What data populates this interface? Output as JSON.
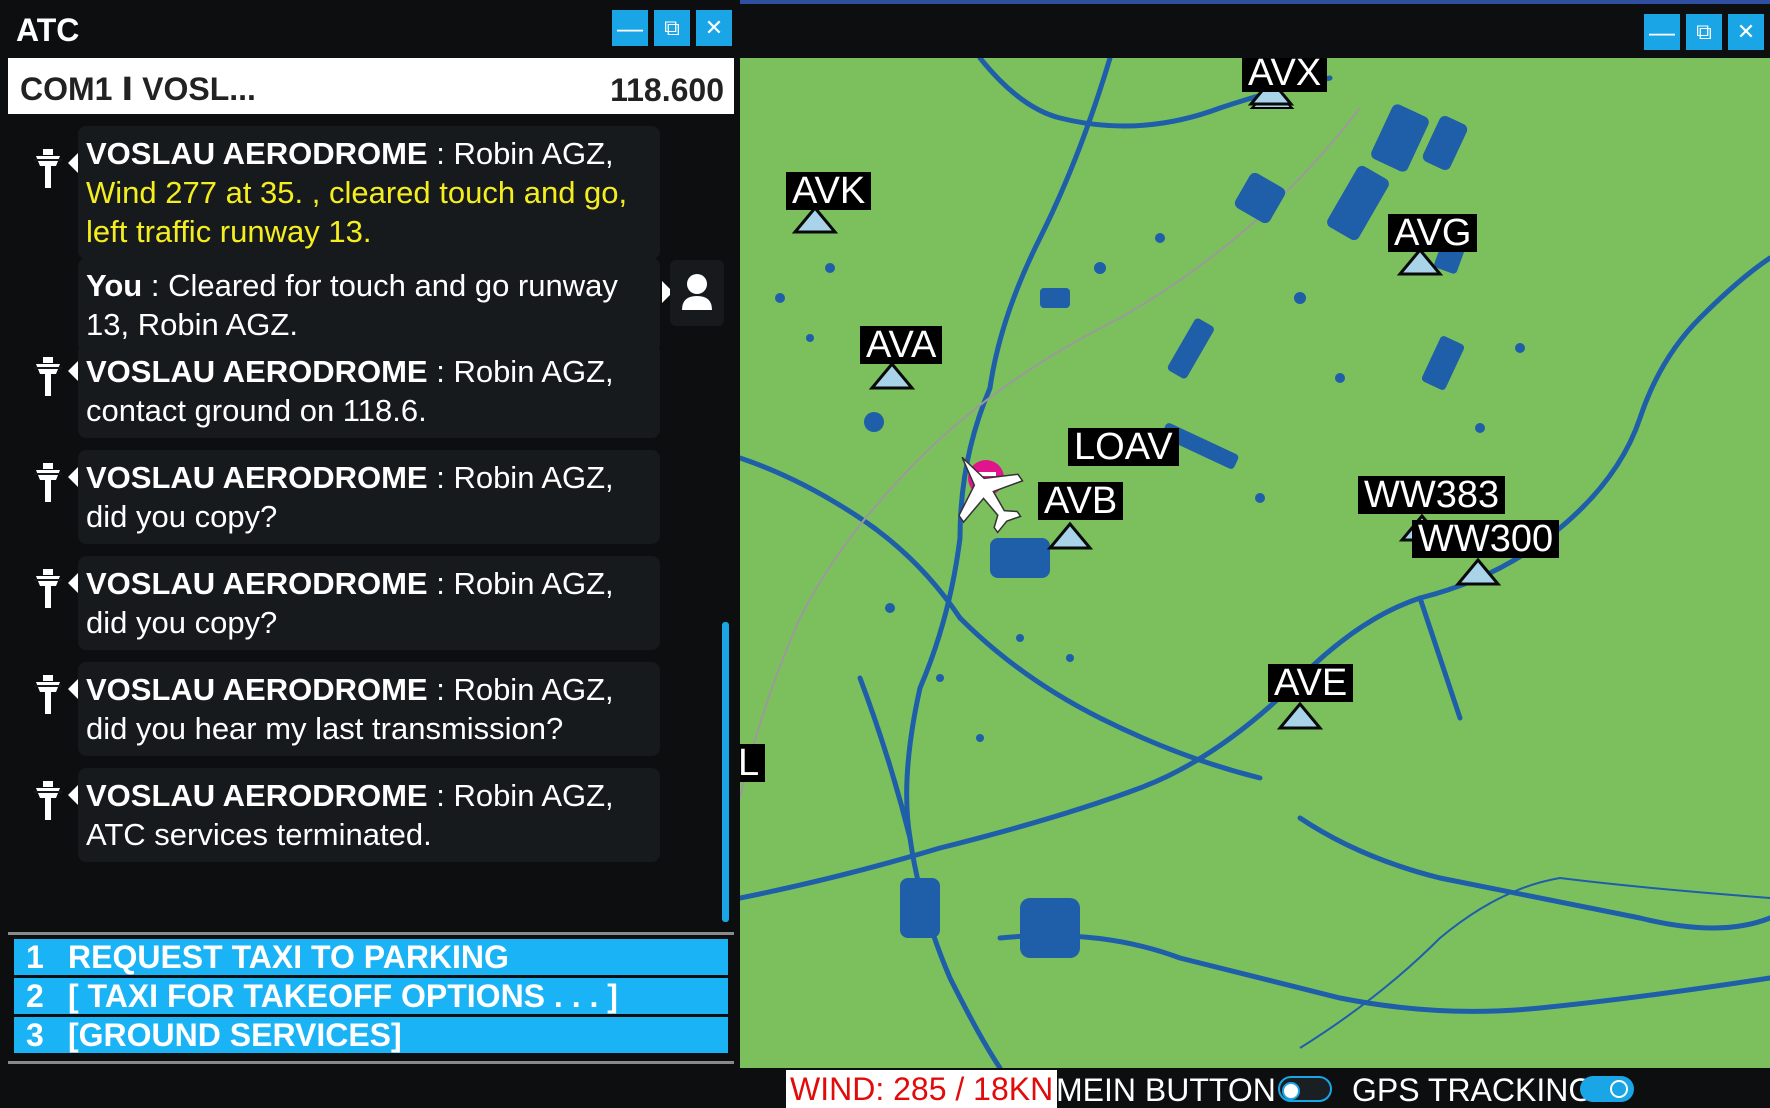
{
  "atc": {
    "title": "ATC",
    "window_buttons": {
      "minimize": "—",
      "popout": "⧉",
      "close": "✕"
    },
    "frequency": {
      "station": "COM1 ꓲ VOSL...",
      "value": "118.600"
    },
    "messages": [
      {
        "speaker": "VOSLAU AERODROME",
        "sep": " : ",
        "text": "Robin AGZ,",
        "highlight": "Wind 277 at 35. , cleared touch and go, left traffic runway 13.",
        "from": "atc"
      },
      {
        "speaker": "You",
        "sep": " : ",
        "text": "Cleared for touch and go runway 13, Robin AGZ.",
        "from": "user"
      },
      {
        "speaker": "VOSLAU AERODROME",
        "sep": " : ",
        "text": "Robin AGZ, contact ground on 118.6.",
        "from": "atc"
      },
      {
        "speaker": "VOSLAU AERODROME",
        "sep": " : ",
        "text": "Robin AGZ, did you copy?",
        "from": "atc"
      },
      {
        "speaker": "VOSLAU AERODROME",
        "sep": " : ",
        "text": "Robin AGZ, did you copy?",
        "from": "atc"
      },
      {
        "speaker": "VOSLAU AERODROME",
        "sep": " : ",
        "text": "Robin AGZ, did you hear my last transmission?",
        "from": "atc"
      },
      {
        "speaker": "VOSLAU AERODROME",
        "sep": " : ",
        "text": "Robin AGZ, ATC services terminated.",
        "from": "atc"
      }
    ],
    "options": [
      {
        "num": "1",
        "label": "REQUEST TAXI TO PARKING"
      },
      {
        "num": "2",
        "label": "[ TAXI FOR TAKEOFF OPTIONS . . . ]"
      },
      {
        "num": "3",
        "label": "[GROUND SERVICES]"
      }
    ]
  },
  "map": {
    "window_buttons": {
      "minimize": "—",
      "popout": "⧉",
      "close": "✕"
    },
    "waypoints": [
      "AVX",
      "AVK",
      "AVG",
      "AVA",
      "LOAV",
      "AVB",
      "WW383",
      "WW300",
      "AVE",
      "L"
    ],
    "status": {
      "wind": "WIND: 285 / 18KN",
      "mein_button_label": "MEIN BUTTON",
      "mein_button_on": false,
      "gps_tracking_label": "GPS TRACKING",
      "gps_tracking_on": true
    },
    "colors": {
      "land": "#7cc05e",
      "water": "#1f5ea8",
      "airport": "#e0158c",
      "accent": "#1aa6e6",
      "highlight": "#f5ee1f"
    }
  }
}
